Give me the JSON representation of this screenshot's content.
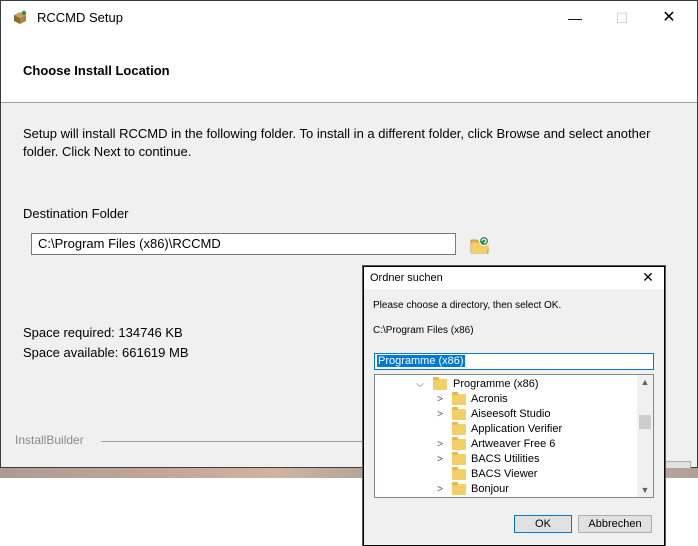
{
  "window": {
    "title": "RCCMD Setup",
    "minimize_glyph": "—",
    "maximize_glyph": "☐",
    "close_glyph": "✕",
    "icon": "installer-box-icon"
  },
  "header": {
    "title": "Choose Install Location"
  },
  "body": {
    "intro": "Setup will install RCCMD in the following folder. To install in a different folder, click Browse and select another folder. Click Next to continue.",
    "destination_label": "Destination Folder",
    "destination_value": "C:\\Program Files (x86)\\RCCMD",
    "space_required": "Space required: 134746 KB",
    "space_available": "Space available: 661619 MB"
  },
  "footer": {
    "brand": "InstallBuilder"
  },
  "browse_dialog": {
    "title": "Ordner suchen",
    "close_glyph": "✕",
    "prompt": "Please choose a directory, then select OK.",
    "current_path": "C:\\Program Files (x86)",
    "edit_value": "Programme (x86)",
    "tree": [
      {
        "label": "Programme (x86)",
        "expander": "expanded",
        "level": 0
      },
      {
        "label": "Acronis",
        "expander": "collapsed",
        "level": 1
      },
      {
        "label": "Aiseesoft Studio",
        "expander": "collapsed",
        "level": 1
      },
      {
        "label": "Application Verifier",
        "expander": "none",
        "level": 1
      },
      {
        "label": "Artweaver Free 6",
        "expander": "collapsed",
        "level": 1
      },
      {
        "label": "BACS Utilities",
        "expander": "collapsed",
        "level": 1
      },
      {
        "label": "BACS Viewer",
        "expander": "none",
        "level": 1
      },
      {
        "label": "Bonjour",
        "expander": "collapsed",
        "level": 1
      }
    ],
    "ok_label": "OK",
    "cancel_label": "Abbrechen"
  },
  "colors": {
    "window_bg": "#f0f0f0",
    "accent": "#0078d7",
    "folder": "#f3cf68"
  }
}
